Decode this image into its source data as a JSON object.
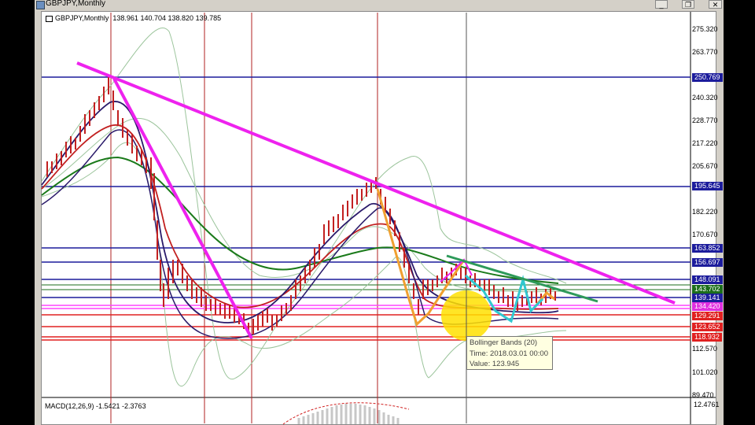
{
  "window": {
    "title": "GBPJPY,Monthly",
    "minimize_label": "_",
    "restore_label": "❐",
    "close_label": "✕"
  },
  "chart": {
    "symbol_label": "GBPJPY,Monthly",
    "open": "138.961",
    "high": "140.704",
    "low": "138.820",
    "close": "139.785",
    "macd_label": "MACD(12,26,9) -1.5421 -2.3763",
    "macd_scale_value": "12.4761"
  },
  "price_scale": [
    "275.320",
    "263.770",
    "240.320",
    "228.770",
    "217.220",
    "205.670",
    "182.220",
    "170.670",
    "112.570",
    "101.020",
    "89.470"
  ],
  "price_tags": [
    {
      "text": "250.769",
      "color": "#1c1c9c"
    },
    {
      "text": "195.645",
      "color": "#1c1c9c"
    },
    {
      "text": "163.852",
      "color": "#1c1c9c"
    },
    {
      "text": "156.697",
      "color": "#1c1c9c"
    },
    {
      "text": "148.091",
      "color": "#1c1c9c"
    },
    {
      "text": "143.702",
      "color": "#1b6e1b"
    },
    {
      "text": "139.141",
      "color": "#1c1c9c"
    },
    {
      "text": "134.420",
      "color": "#e02ee0"
    },
    {
      "text": "129.291",
      "color": "#e02020"
    },
    {
      "text": "123.652",
      "color": "#e02020"
    },
    {
      "text": "118.932",
      "color": "#e02020"
    }
  ],
  "tooltip": {
    "line1": "Bollinger Bands (20)",
    "line2": "Time: 2018.03.01 00:00",
    "line3": "Value: 123.945"
  },
  "colors": {
    "trendline": "#ee22ee",
    "horizontal_blue": "#1c1c9c",
    "horizontal_red": "#e02020",
    "horizontal_pink": "#ff44ff",
    "horizontal_green": "#1b6e1b",
    "vertical_red": "#b22222",
    "zigzag_orange": "#f0a030",
    "zigzag_cyan": "#30c8d0",
    "highlight": "#ffe000"
  }
}
